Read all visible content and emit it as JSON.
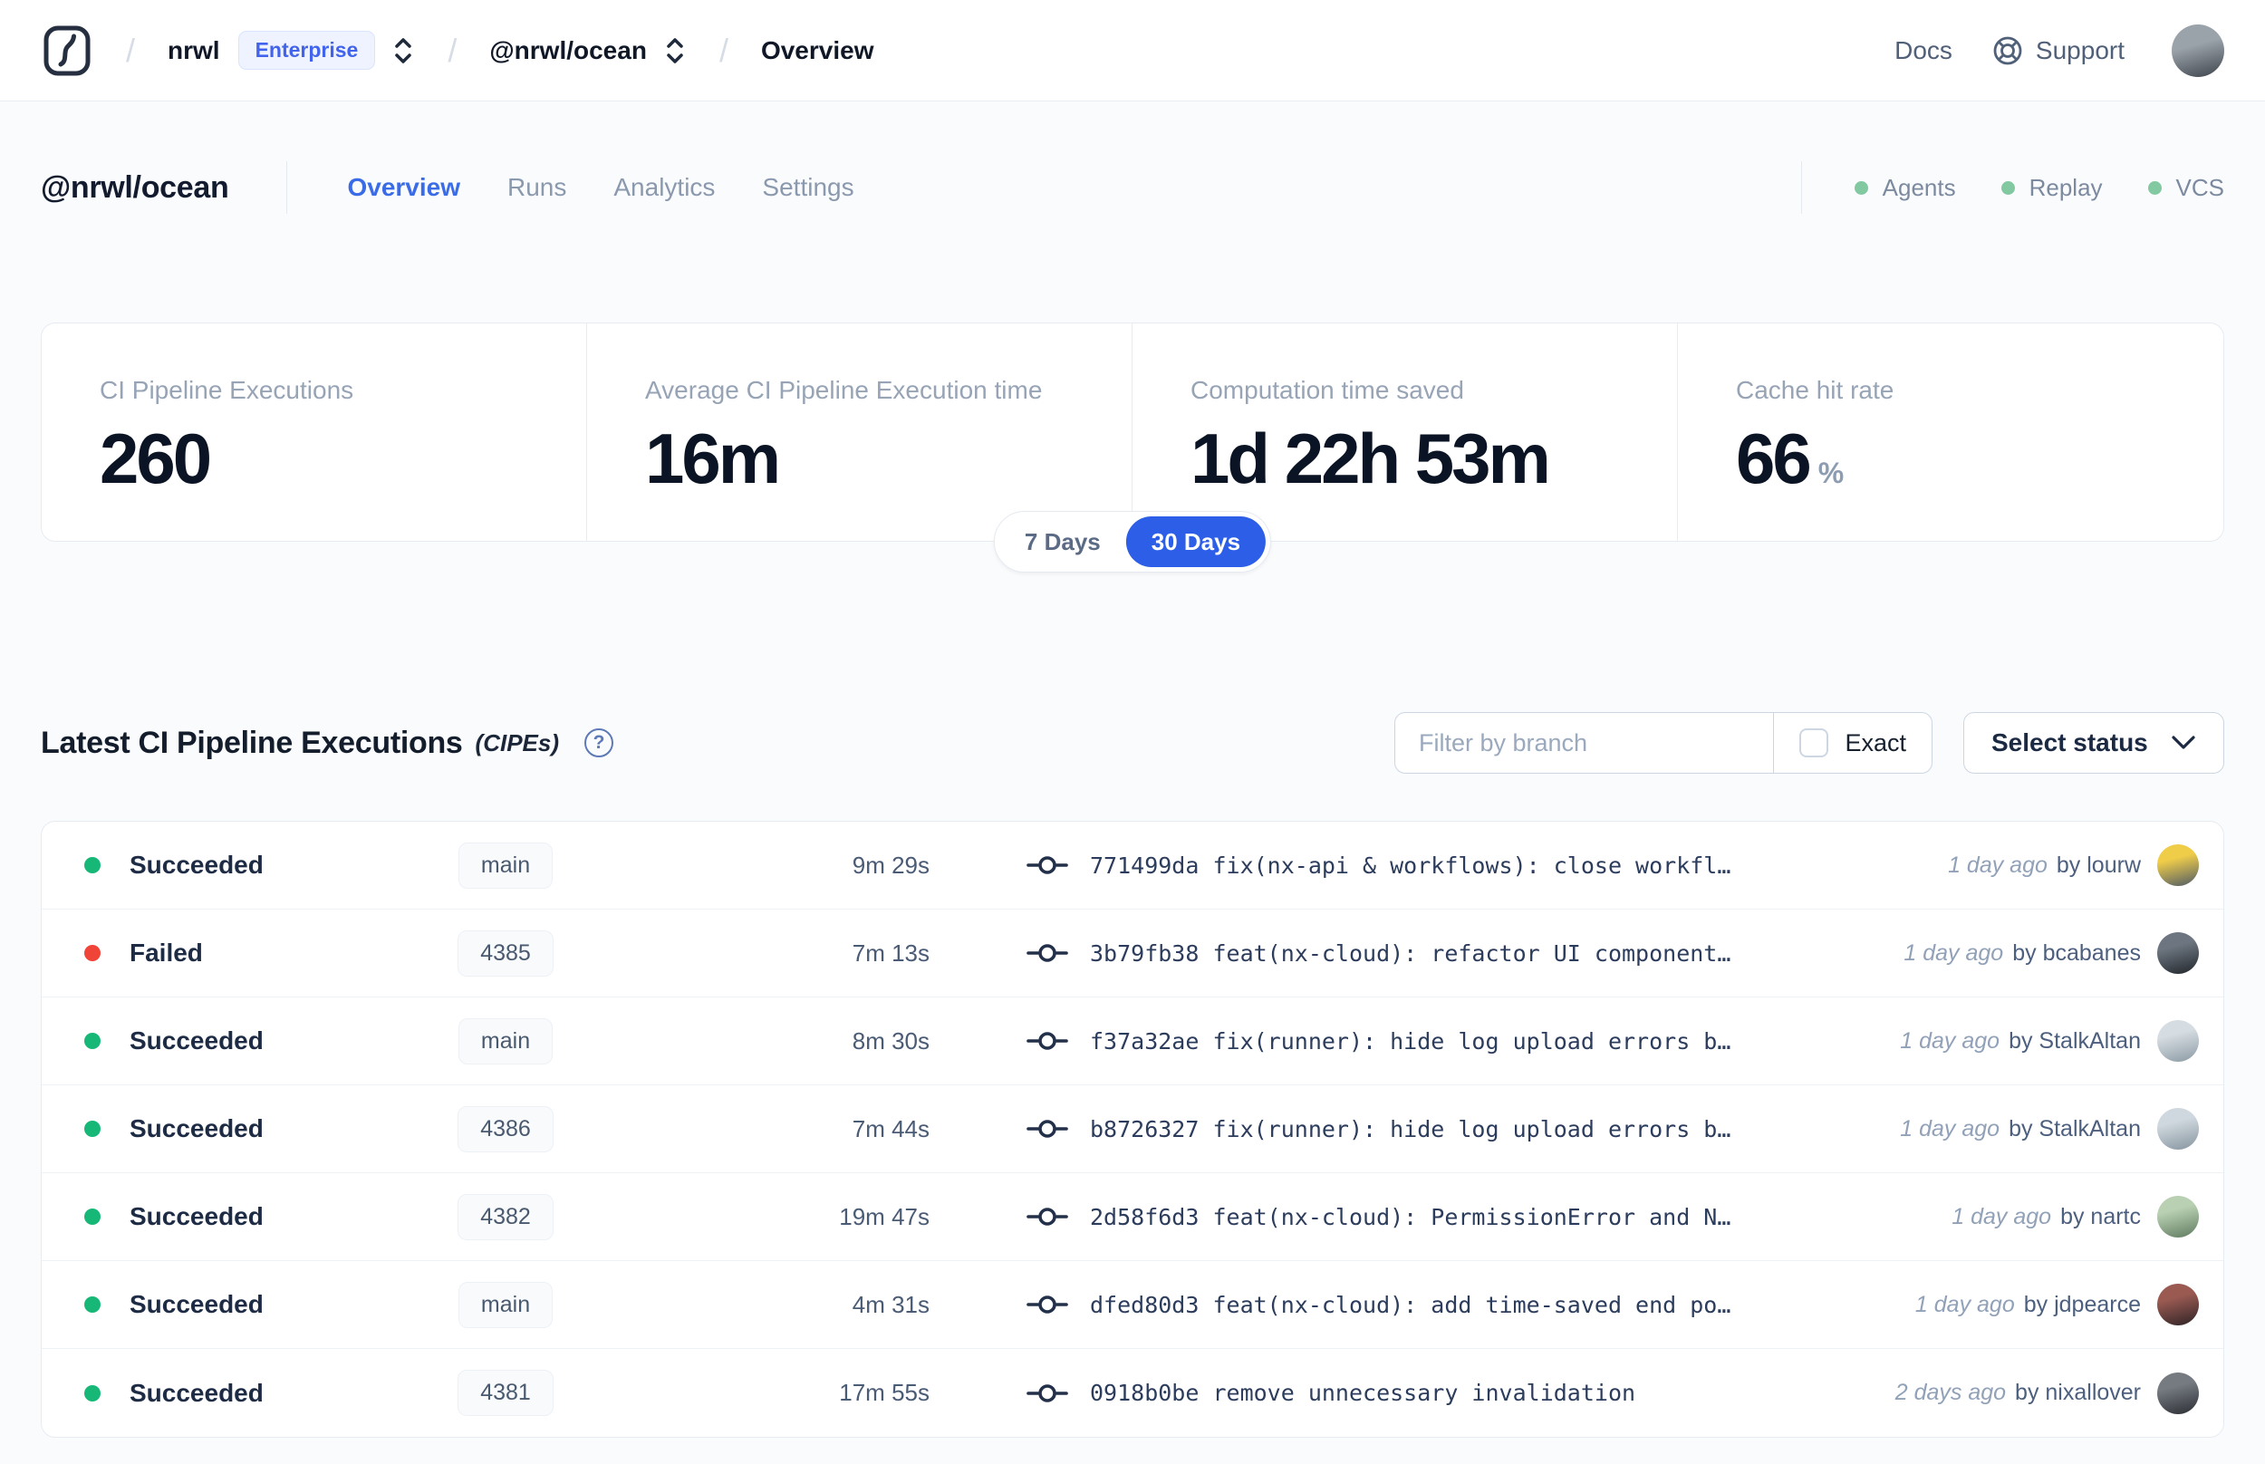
{
  "topbar": {
    "sep": "/",
    "breadcrumb": {
      "org": "nrwl",
      "badge": "Enterprise",
      "workspace": "@nrwl/ocean",
      "page": "Overview"
    },
    "docs_label": "Docs",
    "support_label": "Support",
    "avatar_colors": [
      "#9aa2aa",
      "#3e444b"
    ]
  },
  "header": {
    "workspace": "@nrwl/ocean",
    "tabs": [
      {
        "label": "Overview",
        "active": true
      },
      {
        "label": "Runs",
        "active": false
      },
      {
        "label": "Analytics",
        "active": false
      },
      {
        "label": "Settings",
        "active": false
      }
    ],
    "legend": [
      {
        "label": "Agents"
      },
      {
        "label": "Replay"
      },
      {
        "label": "VCS"
      }
    ]
  },
  "stats": {
    "cards": [
      {
        "label": "CI Pipeline Executions",
        "value": "260",
        "suffix": ""
      },
      {
        "label": "Average CI Pipeline Execution time",
        "value": "16m",
        "suffix": ""
      },
      {
        "label": "Computation time saved",
        "value": "1d 22h 53m",
        "suffix": ""
      },
      {
        "label": "Cache hit rate",
        "value": "66",
        "suffix": "%"
      }
    ],
    "range_toggle": {
      "options": [
        "7 Days",
        "30 Days"
      ],
      "selected": "30 Days"
    }
  },
  "executions": {
    "title": "Latest CI Pipeline Executions",
    "title_suffix": "(CIPEs)",
    "help_glyph": "?",
    "filter_placeholder": "Filter by branch",
    "exact_label": "Exact",
    "status_dropdown_label": "Select status",
    "rows": [
      {
        "status": "Succeeded",
        "status_color": "#17b877",
        "branch": "main",
        "duration": "9m 29s",
        "commit": "771499da fix(nx-api & workflows): close workfl…",
        "time": "1 day ago",
        "author": "by lourw",
        "avatar": [
          "#f0cd49",
          "#4e5a66"
        ]
      },
      {
        "status": "Failed",
        "status_color": "#f04438",
        "branch": "4385",
        "duration": "7m 13s",
        "commit": "3b79fb38 feat(nx-cloud): refactor UI component…",
        "time": "1 day ago",
        "author": "by bcabanes",
        "avatar": [
          "#6d7680",
          "#22262c"
        ]
      },
      {
        "status": "Succeeded",
        "status_color": "#17b877",
        "branch": "main",
        "duration": "8m 30s",
        "commit": "f37a32ae fix(runner): hide log upload errors b…",
        "time": "1 day ago",
        "author": "by StalkAltan",
        "avatar": [
          "#d6dde2",
          "#8c9aa4"
        ]
      },
      {
        "status": "Succeeded",
        "status_color": "#17b877",
        "branch": "4386",
        "duration": "7m 44s",
        "commit": "b8726327 fix(runner): hide log upload errors b…",
        "time": "1 day ago",
        "author": "by StalkAltan",
        "avatar": [
          "#cfd8de",
          "#87959f"
        ]
      },
      {
        "status": "Succeeded",
        "status_color": "#17b877",
        "branch": "4382",
        "duration": "19m 47s",
        "commit": "2d58f6d3 feat(nx-cloud): PermissionError and N…",
        "time": "1 day ago",
        "author": "by nartc",
        "avatar": [
          "#b9d0b2",
          "#5f7a60"
        ]
      },
      {
        "status": "Succeeded",
        "status_color": "#17b877",
        "branch": "main",
        "duration": "4m 31s",
        "commit": "dfed80d3 feat(nx-cloud): add time-saved end po…",
        "time": "1 day ago",
        "author": "by jdpearce",
        "avatar": [
          "#9a5a52",
          "#2e2326"
        ]
      },
      {
        "status": "Succeeded",
        "status_color": "#17b877",
        "branch": "4381",
        "duration": "17m 55s",
        "commit": "0918b0be remove unnecessary invalidation",
        "time": "2 days ago",
        "author": "by nixallover",
        "avatar": [
          "#767b82",
          "#2b2e33"
        ]
      }
    ]
  },
  "colors": {
    "accent_blue": "#2c5ee8",
    "success_green": "#17b877",
    "fail_red": "#f04438",
    "legend_green": "#82c9a1"
  }
}
